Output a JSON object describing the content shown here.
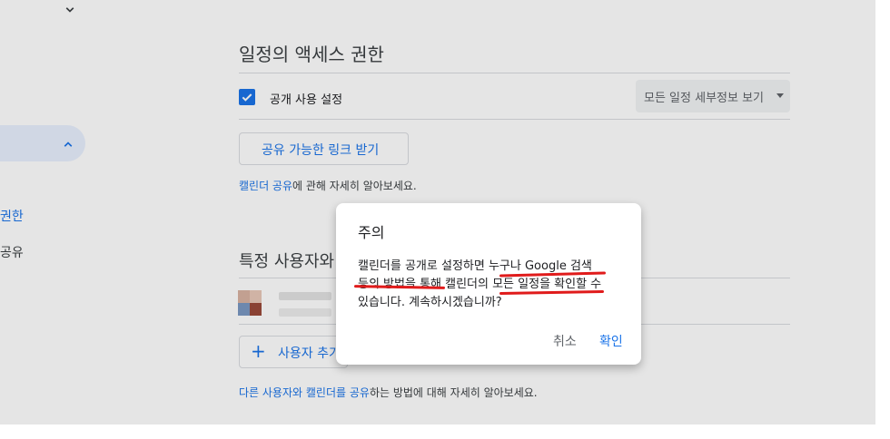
{
  "sidebar": {
    "link_permissions": "권한",
    "link_share": "공유"
  },
  "access": {
    "title": "일정의 액세스 권한",
    "public_checkbox_label": "공개 사용 설정",
    "public_checked": true,
    "visibility_select_value": "모든 일정 세부정보 보기",
    "shareable_link_button": "공유 가능한 링크 받기",
    "help_link": "캘린더 공유",
    "help_text": "에 관해 자세히 알아보세요."
  },
  "share_specific": {
    "title": "특정 사용자와",
    "add_user_button": "사용자 추가",
    "help_link": "다른 사용자와 캘린더를 공유",
    "help_text": "하는 방법에 대해 자세히 알아보세요."
  },
  "dialog": {
    "title": "주의",
    "body_line1_a": "캘린더를 공개로 설정하면 ",
    "body_line1_b": "누구나 Google 검색",
    "body_line2_a": "등의 방법을 통해 캘린더의 ",
    "body_line2_b": "모든 일정을 확인",
    "body_line2_c": "할 수",
    "body_line3": "있습니다. 계속하시겠습니까?",
    "cancel_button": "취소",
    "confirm_button": "확인"
  },
  "colors": {
    "accent": "#1a73e8",
    "annotation_red": "#e01b1b"
  }
}
